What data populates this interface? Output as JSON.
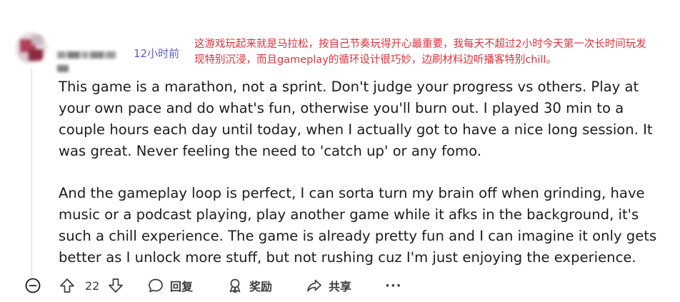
{
  "comment": {
    "timestamp": "12小时前",
    "annotation": "这游戏玩起来就是马拉松，按自己节奏玩得开心最重要，我每天不超过2小时今天第一次长时间玩发现特别沉浸，而且gameplay的循环设计很巧妙，边刷材料边听播客特别chill。",
    "paragraphs": [
      "This game is a marathon, not a sprint. Don't judge your progress vs others. Play at your own pace and do what's fun, otherwise you'll burn out. I played 30 min to a couple hours each day until today, when I actually got to have a nice long session. It was great. Never feeling the need to 'catch up' or any fomo.",
      "And the gameplay loop is perfect, I can sorta turn my brain off when grinding, have music or a podcast playing, play another game while it afks in the background, it's such a chill experience. The game is already pretty fun and I can imagine it only gets better as I unlock more stuff, but not rushing cuz I'm just enjoying the experience."
    ]
  },
  "actions": {
    "vote_count": "22",
    "reply_label": "回复",
    "award_label": "奖励",
    "share_label": "共享",
    "more_label": "···"
  },
  "colors": {
    "timestamp": "#5b5fd6",
    "annotation": "#e0303a",
    "text": "#1c1c1c",
    "icon": "#3c3c3c"
  },
  "icons": {
    "collapse": "minus-circle-icon",
    "upvote": "arrow-up-icon",
    "downvote": "arrow-down-icon",
    "reply": "speech-bubble-icon",
    "award": "award-ribbon-icon",
    "share": "share-arrow-icon"
  }
}
